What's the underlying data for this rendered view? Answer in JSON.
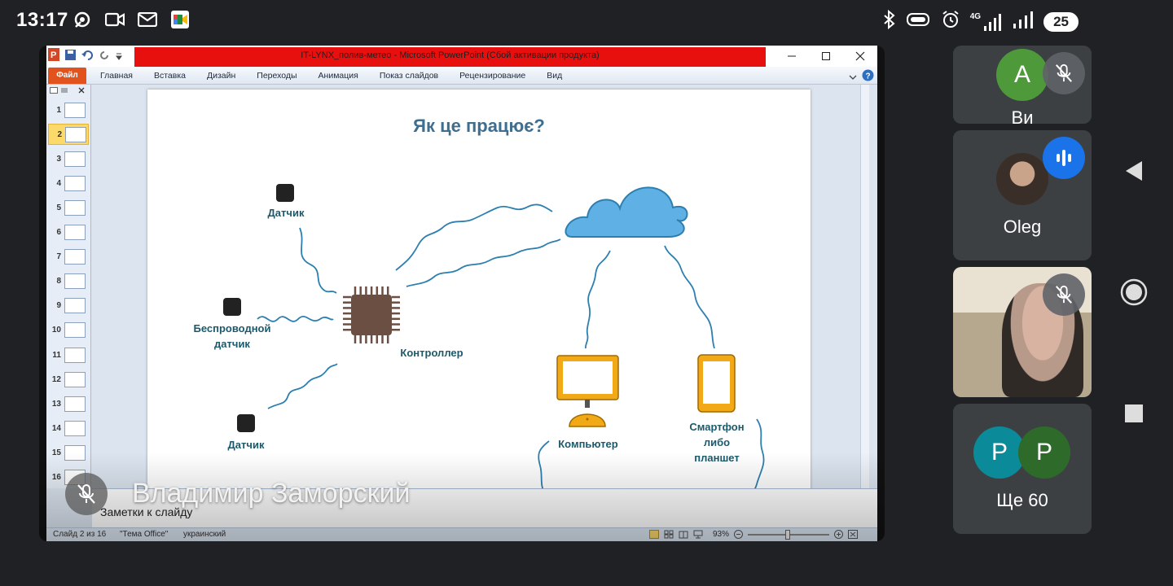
{
  "status_bar": {
    "time": "13:17",
    "network": "4G",
    "battery": "25"
  },
  "powerpoint": {
    "window_title": "IT-LYNX_полив-метео  -  Microsoft PowerPoint (Сбой активации продукта)",
    "ribbon": {
      "file": "Файл",
      "tabs": [
        "Главная",
        "Вставка",
        "Дизайн",
        "Переходы",
        "Анимация",
        "Показ слайдов",
        "Рецензирование",
        "Вид"
      ]
    },
    "thumbnails": [
      "1",
      "2",
      "3",
      "4",
      "5",
      "6",
      "7",
      "8",
      "9",
      "10",
      "11",
      "12",
      "13",
      "14",
      "15",
      "16"
    ],
    "selected_thumbnail": 2,
    "slide": {
      "title": "Як це працює?",
      "labels": {
        "sensor_top": "Датчик",
        "wireless_1": "Беспроводной",
        "wireless_2": "датчик",
        "sensor_bottom": "Датчик",
        "controller": "Контроллер",
        "computer": "Компьютер",
        "phone_1": "Смартфон",
        "phone_2": "либо",
        "phone_3": "планшет"
      },
      "colors": {
        "title": "#3f6e8f",
        "label": "#1c5a6b",
        "wire": "#2d7fb0",
        "chip": "#6b4f43",
        "cloud": "#5eb0e5",
        "device": "#f2a917",
        "sensor": "#222222"
      }
    },
    "notes_placeholder": "Заметки к слайду",
    "status": {
      "slide_counter": "Слайд 2 из 16",
      "theme": "\"Тема Office\"",
      "language": "украинский",
      "zoom": "93%"
    }
  },
  "active_speaker": "Владимир Заморский",
  "participants": [
    {
      "initial": "A",
      "name": "Ви",
      "avatar_color": "#4e9a3a",
      "muted": true
    },
    {
      "initial": "",
      "name": "Oleg",
      "avatar_color": "#6b5a4a",
      "muted": false,
      "speaking": true
    },
    {
      "initial": "",
      "name": "",
      "muted": true,
      "video": true
    },
    {
      "initials": [
        "P",
        "P"
      ],
      "name": "Ще 60",
      "avatar_colors": [
        "#0b8a9a",
        "#2e6b2a"
      ]
    }
  ]
}
